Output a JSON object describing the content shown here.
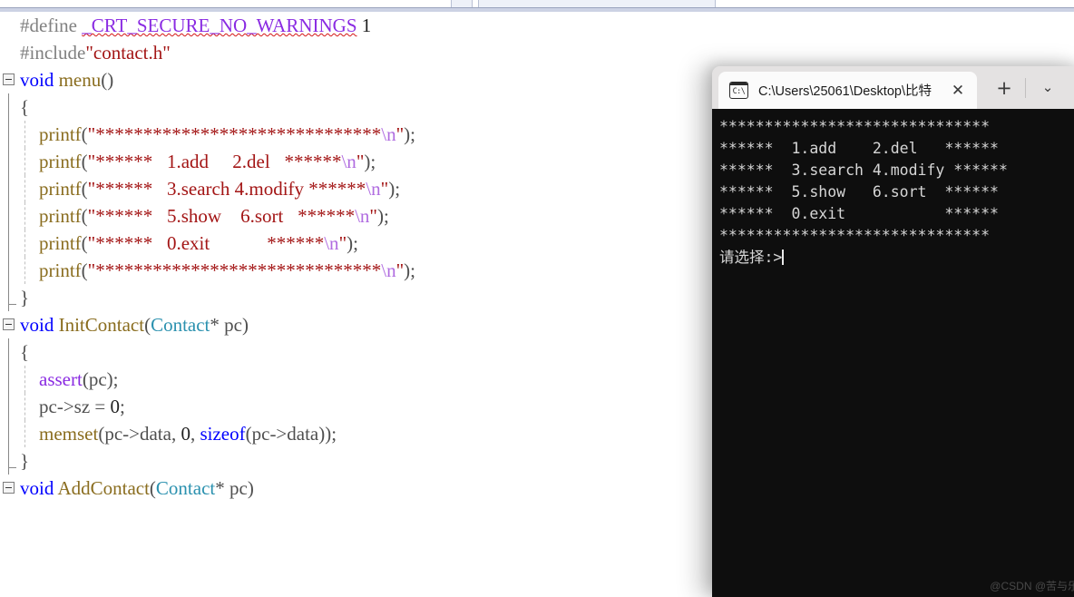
{
  "editor": {
    "lines": [
      {
        "fold": "open",
        "indent_guide": false,
        "tokens": [
          {
            "t": "#define ",
            "c": "tok-pre"
          },
          {
            "t": "_CRT_SECURE_NO_WARNINGS",
            "c": "tok-macro squiggle"
          },
          {
            "t": " ",
            "c": "tok-plain"
          },
          {
            "t": "1",
            "c": "tok-num"
          }
        ]
      },
      {
        "fold": "none",
        "indent_guide": false,
        "tokens": [
          {
            "t": "#include",
            "c": "tok-pre"
          },
          {
            "t": "\"contact.h\"",
            "c": "tok-str"
          }
        ]
      },
      {
        "fold": "box",
        "indent_guide": false,
        "tokens": [
          {
            "t": "void",
            "c": "tok-kw"
          },
          {
            "t": " ",
            "c": "tok-plain"
          },
          {
            "t": "menu",
            "c": "tok-fn"
          },
          {
            "t": "()",
            "c": "tok-plain"
          }
        ]
      },
      {
        "fold": "rail",
        "indent_guide": false,
        "tokens": [
          {
            "t": "{",
            "c": "tok-plain"
          }
        ]
      },
      {
        "fold": "rail",
        "indent_guide": true,
        "tokens": [
          {
            "t": "    ",
            "c": "tok-plain"
          },
          {
            "t": "printf",
            "c": "tok-fn"
          },
          {
            "t": "(",
            "c": "tok-plain"
          },
          {
            "t": "\"******************************",
            "c": "tok-str"
          },
          {
            "t": "\\n",
            "c": "tok-esc"
          },
          {
            "t": "\"",
            "c": "tok-str"
          },
          {
            "t": ");",
            "c": "tok-plain"
          }
        ]
      },
      {
        "fold": "rail",
        "indent_guide": true,
        "tokens": [
          {
            "t": "    ",
            "c": "tok-plain"
          },
          {
            "t": "printf",
            "c": "tok-fn"
          },
          {
            "t": "(",
            "c": "tok-plain"
          },
          {
            "t": "\"******   1.add     2.del   ******",
            "c": "tok-str"
          },
          {
            "t": "\\n",
            "c": "tok-esc"
          },
          {
            "t": "\"",
            "c": "tok-str"
          },
          {
            "t": ");",
            "c": "tok-plain"
          }
        ]
      },
      {
        "fold": "rail",
        "indent_guide": true,
        "tokens": [
          {
            "t": "    ",
            "c": "tok-plain"
          },
          {
            "t": "printf",
            "c": "tok-fn"
          },
          {
            "t": "(",
            "c": "tok-plain"
          },
          {
            "t": "\"******   3.search 4.modify ******",
            "c": "tok-str"
          },
          {
            "t": "\\n",
            "c": "tok-esc"
          },
          {
            "t": "\"",
            "c": "tok-str"
          },
          {
            "t": ");",
            "c": "tok-plain"
          }
        ]
      },
      {
        "fold": "rail",
        "indent_guide": true,
        "tokens": [
          {
            "t": "    ",
            "c": "tok-plain"
          },
          {
            "t": "printf",
            "c": "tok-fn"
          },
          {
            "t": "(",
            "c": "tok-plain"
          },
          {
            "t": "\"******   5.show    6.sort   ******",
            "c": "tok-str"
          },
          {
            "t": "\\n",
            "c": "tok-esc"
          },
          {
            "t": "\"",
            "c": "tok-str"
          },
          {
            "t": ");",
            "c": "tok-plain"
          }
        ]
      },
      {
        "fold": "rail",
        "indent_guide": true,
        "tokens": [
          {
            "t": "    ",
            "c": "tok-plain"
          },
          {
            "t": "printf",
            "c": "tok-fn"
          },
          {
            "t": "(",
            "c": "tok-plain"
          },
          {
            "t": "\"******   0.exit            ******",
            "c": "tok-str"
          },
          {
            "t": "\\n",
            "c": "tok-esc"
          },
          {
            "t": "\"",
            "c": "tok-str"
          },
          {
            "t": ");",
            "c": "tok-plain"
          }
        ]
      },
      {
        "fold": "rail",
        "indent_guide": true,
        "tokens": [
          {
            "t": "    ",
            "c": "tok-plain"
          },
          {
            "t": "printf",
            "c": "tok-fn"
          },
          {
            "t": "(",
            "c": "tok-plain"
          },
          {
            "t": "\"******************************",
            "c": "tok-str"
          },
          {
            "t": "\\n",
            "c": "tok-esc"
          },
          {
            "t": "\"",
            "c": "tok-str"
          },
          {
            "t": ");",
            "c": "tok-plain"
          }
        ]
      },
      {
        "fold": "railend",
        "indent_guide": false,
        "tokens": [
          {
            "t": "}",
            "c": "tok-plain"
          }
        ]
      },
      {
        "fold": "box",
        "indent_guide": false,
        "tokens": [
          {
            "t": "void",
            "c": "tok-kw"
          },
          {
            "t": " ",
            "c": "tok-plain"
          },
          {
            "t": "InitContact",
            "c": "tok-fn"
          },
          {
            "t": "(",
            "c": "tok-plain"
          },
          {
            "t": "Contact",
            "c": "tok-type"
          },
          {
            "t": "* pc)",
            "c": "tok-plain"
          }
        ]
      },
      {
        "fold": "rail",
        "indent_guide": false,
        "tokens": [
          {
            "t": "{",
            "c": "tok-plain"
          }
        ]
      },
      {
        "fold": "rail",
        "indent_guide": true,
        "tokens": [
          {
            "t": "    ",
            "c": "tok-plain"
          },
          {
            "t": "assert",
            "c": "tok-assert"
          },
          {
            "t": "(pc);",
            "c": "tok-plain"
          }
        ]
      },
      {
        "fold": "rail",
        "indent_guide": true,
        "tokens": [
          {
            "t": "    ",
            "c": "tok-plain"
          },
          {
            "t": "pc->sz = ",
            "c": "tok-plain"
          },
          {
            "t": "0",
            "c": "tok-num"
          },
          {
            "t": ";",
            "c": "tok-plain"
          }
        ]
      },
      {
        "fold": "rail",
        "indent_guide": true,
        "tokens": [
          {
            "t": "    ",
            "c": "tok-plain"
          },
          {
            "t": "memset",
            "c": "tok-fn"
          },
          {
            "t": "(pc->data, ",
            "c": "tok-plain"
          },
          {
            "t": "0",
            "c": "tok-num"
          },
          {
            "t": ", ",
            "c": "tok-plain"
          },
          {
            "t": "sizeof",
            "c": "tok-kw"
          },
          {
            "t": "(pc->data));",
            "c": "tok-plain"
          }
        ]
      },
      {
        "fold": "railend",
        "indent_guide": false,
        "tokens": [
          {
            "t": "}",
            "c": "tok-plain"
          }
        ]
      },
      {
        "fold": "box",
        "indent_guide": false,
        "tokens": [
          {
            "t": "void",
            "c": "tok-kw"
          },
          {
            "t": " ",
            "c": "tok-plain"
          },
          {
            "t": "AddContact",
            "c": "tok-fn"
          },
          {
            "t": "(",
            "c": "tok-plain"
          },
          {
            "t": "Contact",
            "c": "tok-type"
          },
          {
            "t": "* pc)",
            "c": "tok-plain"
          }
        ]
      }
    ]
  },
  "terminal": {
    "tab": {
      "icon": "console-icon",
      "icon_glyph": "C:\\",
      "title": "C:\\Users\\25061\\Desktop\\比特",
      "close_glyph": "✕"
    },
    "newtab_glyph": "+",
    "dropdown_glyph": "⌄",
    "output": [
      "******************************",
      "******  1.add    2.del   ******",
      "******  3.search 4.modify ******",
      "******  5.show   6.sort  ******",
      "******  0.exit           ******",
      "******************************",
      "请选择:>"
    ],
    "watermark": "@CSDN @苦与乐"
  },
  "colors": {
    "terminal_bg": "#0e0e0e",
    "terminal_fg": "#d6d6d6",
    "titlebar_bg": "#e4e2e2",
    "tab_bg": "#fbfbfb",
    "keyword": "#0000ff",
    "string": "#a31515",
    "macro": "#8a2be2",
    "type": "#2b91af",
    "function": "#8a6d1f",
    "preproc": "#808080",
    "escape": "#b06ce0"
  }
}
